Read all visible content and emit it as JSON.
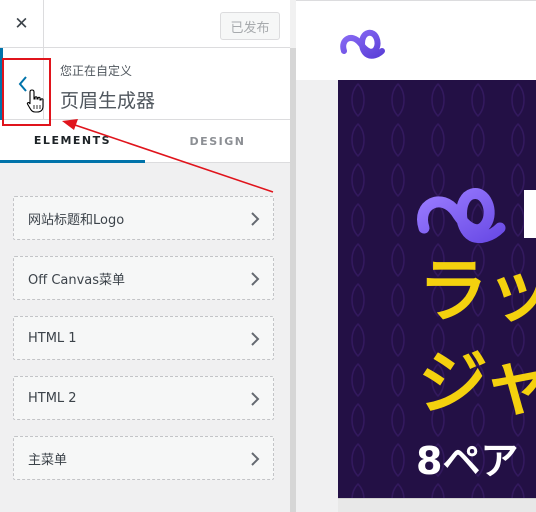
{
  "topbar": {
    "close_label": "✕",
    "publish_label": "已发布"
  },
  "section": {
    "subtitle": "您正在自定义",
    "title": "页眉生成器"
  },
  "tabs": [
    {
      "label": "ELEMENTS",
      "active": true
    },
    {
      "label": "DESIGN",
      "active": false
    }
  ],
  "items": [
    {
      "label": "网站标题和Logo"
    },
    {
      "label": "Off Canvas菜单"
    },
    {
      "label": "HTML 1"
    },
    {
      "label": "HTML 2"
    },
    {
      "label": "主菜单"
    }
  ],
  "preview": {
    "banner_line1": "ラッ",
    "banner_line2": "ジャ",
    "banner_line3": "8ペア"
  },
  "colors": {
    "accent": "#0073aa",
    "annotation": "#e0141c",
    "logo_purple": "#7b5cf0",
    "banner_bg": "#231045",
    "banner_yellow": "#f4d10e"
  }
}
